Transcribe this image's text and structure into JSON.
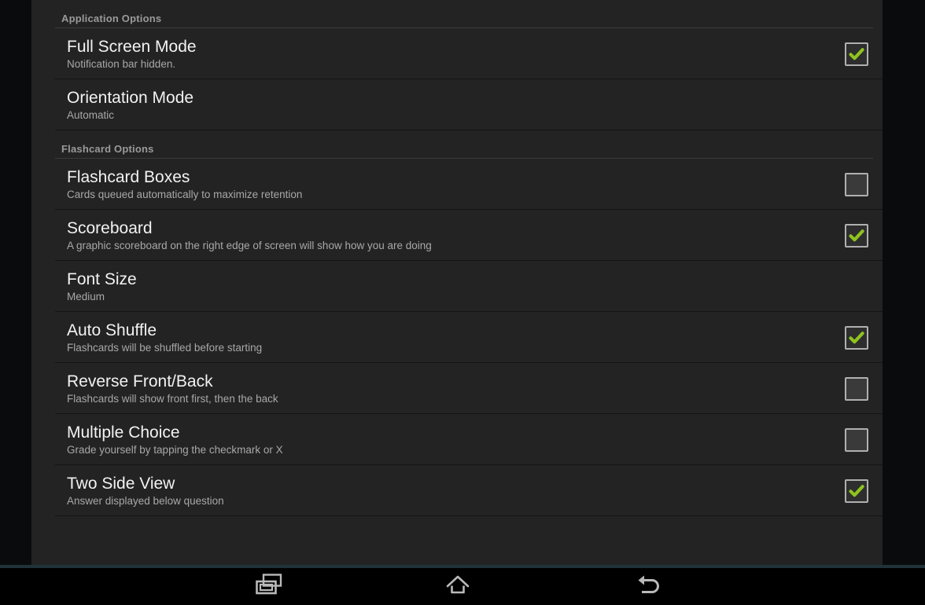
{
  "screen": {
    "background_color": "#060708",
    "panel_color": "#232323",
    "gutter_color": "#0a0b0d",
    "accent_check_color": "#8fc31f",
    "seam_color": "#21333a"
  },
  "sections": [
    {
      "header": "Application Options",
      "rows": [
        {
          "title": "Full Screen Mode",
          "summary": "Notification bar hidden.",
          "control": "checkbox",
          "checked": true
        },
        {
          "title": "Orientation Mode",
          "summary": "Automatic",
          "control": "none",
          "checked": false
        }
      ]
    },
    {
      "header": "Flashcard Options",
      "rows": [
        {
          "title": "Flashcard Boxes",
          "summary": "Cards queued automatically to maximize retention",
          "control": "checkbox",
          "checked": false
        },
        {
          "title": "Scoreboard",
          "summary": "A graphic scoreboard on the right edge of screen will show how you are doing",
          "control": "checkbox",
          "checked": true
        },
        {
          "title": "Font Size",
          "summary": "Medium",
          "control": "none",
          "checked": false
        },
        {
          "title": "Auto Shuffle",
          "summary": "Flashcards will be shuffled before starting",
          "control": "checkbox",
          "checked": true
        },
        {
          "title": "Reverse Front/Back",
          "summary": "Flashcards will show front first, then the back",
          "control": "checkbox",
          "checked": false
        },
        {
          "title": "Multiple Choice",
          "summary": "Grade yourself by tapping the checkmark or X",
          "control": "checkbox",
          "checked": false
        },
        {
          "title": "Two Side View",
          "summary": "Answer displayed below question",
          "control": "checkbox",
          "checked": true
        }
      ]
    }
  ],
  "navbar": {
    "buttons": [
      {
        "icon": "recents-icon",
        "label": "Recent apps"
      },
      {
        "icon": "home-icon",
        "label": "Home"
      },
      {
        "icon": "back-icon",
        "label": "Back"
      }
    ]
  }
}
